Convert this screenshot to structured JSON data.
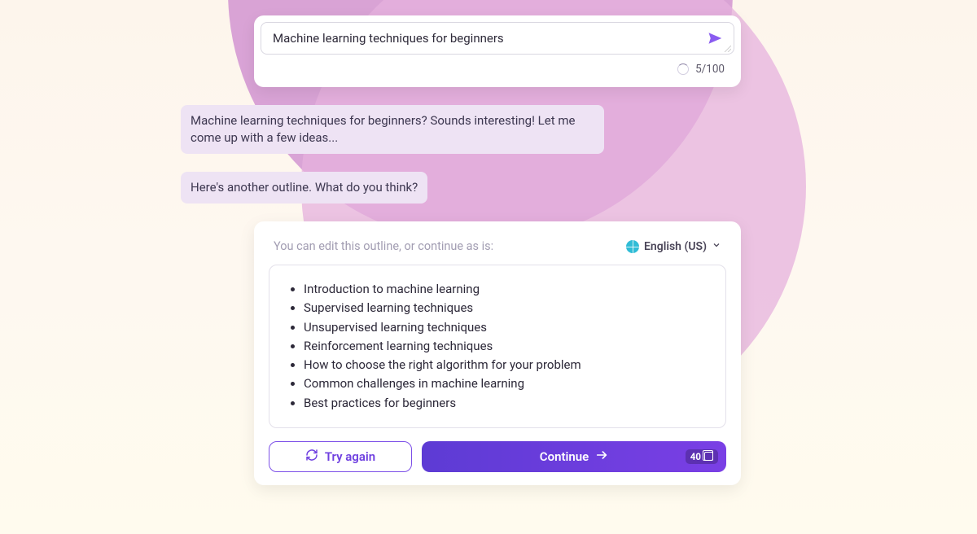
{
  "input": {
    "value": "Machine learning techniques for beginners",
    "counter": "5/100"
  },
  "chat": {
    "bubble1": "Machine learning techniques for beginners? Sounds interesting! Let me come up with a few ideas...",
    "bubble2": "Here's another outline. What do you think?"
  },
  "outline": {
    "hint": "You can edit this outline, or continue as is:",
    "language": "English (US)",
    "items": [
      "Introduction to machine learning",
      "Supervised learning techniques",
      "Unsupervised learning techniques",
      "Reinforcement learning techniques",
      "How to choose the right algorithm for your problem",
      "Common challenges in machine learning",
      "Best practices for beginners"
    ]
  },
  "buttons": {
    "try_again": "Try again",
    "continue": "Continue",
    "credits": "40"
  }
}
